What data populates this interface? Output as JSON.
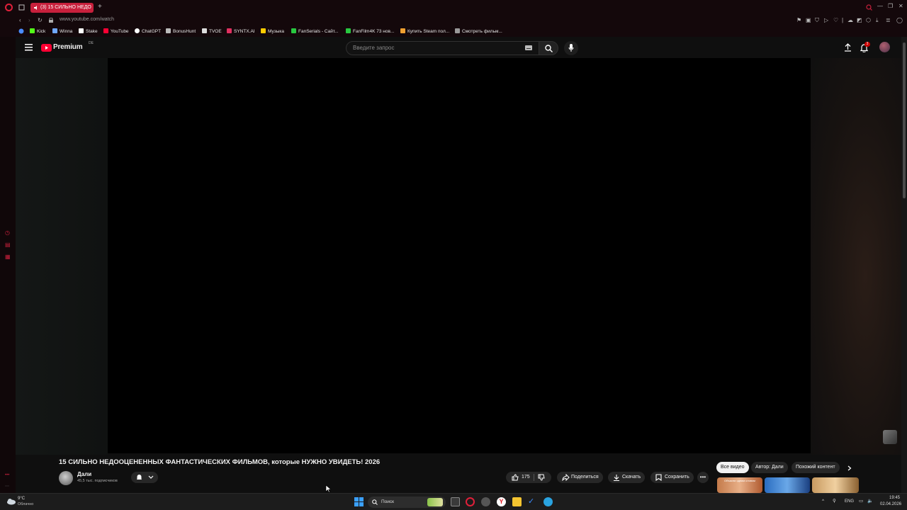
{
  "browser": {
    "tab_title": "(3) 15 СИЛЬНО НЕДО",
    "url": "www.youtube.com/watch",
    "bookmarks": [
      {
        "label": "Kick",
        "color": "#53fc18"
      },
      {
        "label": "Winna",
        "color": "#6fa8ff"
      },
      {
        "label": "Stake",
        "color": "#ffffff"
      },
      {
        "label": "YouTube",
        "color": "#ff0033"
      },
      {
        "label": "ChatGPT",
        "color": "#ffffff"
      },
      {
        "label": "BonusHunt",
        "color": "#bbbbbb"
      },
      {
        "label": "TVOE",
        "color": "#dddddd"
      },
      {
        "label": "SYNTX.AI",
        "color": "#e03060"
      },
      {
        "label": "Музыка",
        "color": "#ffcc00"
      },
      {
        "label": "FanSerials - Сайт...",
        "color": "#28c840"
      },
      {
        "label": "FanFilm4K 73 нов...",
        "color": "#28c840"
      },
      {
        "label": "Купить Steam пол...",
        "color": "#f0a030"
      },
      {
        "label": "Смотреть фильм...",
        "color": "#999999"
      }
    ]
  },
  "youtube": {
    "logo_text": "Premium",
    "logo_region": "DE",
    "search_placeholder": "Введите запрос",
    "notification_count": "3",
    "video_title": "15 СИЛЬНО НЕДООЦЕНЕННЫХ ФАНТАСТИЧЕСКИХ ФИЛЬМОВ, которые НУЖНО УВИДЕТЬ! 2026",
    "channel_name": "Дали",
    "subscribers": "45,5 тыс. подписчиков",
    "likes": "175",
    "share_label": "Поделиться",
    "download_label": "Скачать",
    "save_label": "Сохранить",
    "chips": [
      "Все видео",
      "Автор: Дали",
      "Похожий контент"
    ],
    "thumb_caption": "Объясни одним словом"
  },
  "taskbar": {
    "weather_temp": "9°C",
    "weather_desc": "Облачно",
    "search_label": "Поиск",
    "lang": "ENG",
    "time": "19:45",
    "date": "02.04.2026"
  },
  "colors": {
    "accent": "#c8203c",
    "youtube_red": "#ff0033",
    "background": "#0f0f0f"
  }
}
